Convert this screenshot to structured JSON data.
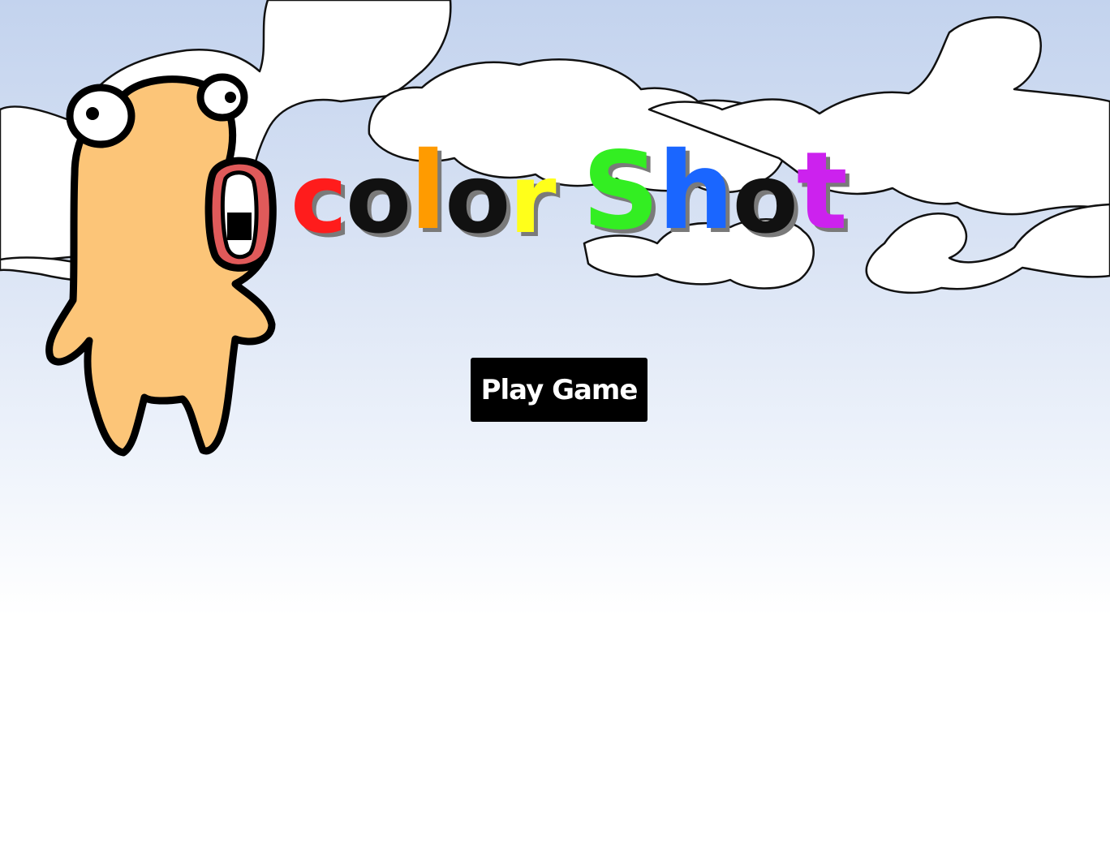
{
  "game": {
    "title_letters": [
      {
        "char": "c",
        "color": "#ff1c1c"
      },
      {
        "char": "o",
        "color": "#111111"
      },
      {
        "char": "l",
        "color": "#ff9b00"
      },
      {
        "char": "o",
        "color": "#111111"
      },
      {
        "char": "r",
        "color": "#ffff1a"
      },
      {
        "char": " ",
        "color": "#ffffff"
      },
      {
        "char": "S",
        "color": "#33ee22"
      },
      {
        "char": "h",
        "color": "#1a66ff"
      },
      {
        "char": "o",
        "color": "#111111"
      },
      {
        "char": "t",
        "color": "#cc22ee"
      }
    ],
    "play_button_label": "Play Game"
  },
  "mascot": {
    "body_color": "#fcc578",
    "outline_color": "#000000",
    "mouth_color": "#e05a5a"
  },
  "colors": {
    "sky_top": "#c3d3ee",
    "cloud": "#ffffff",
    "button_bg": "#000000",
    "button_text": "#ffffff"
  }
}
